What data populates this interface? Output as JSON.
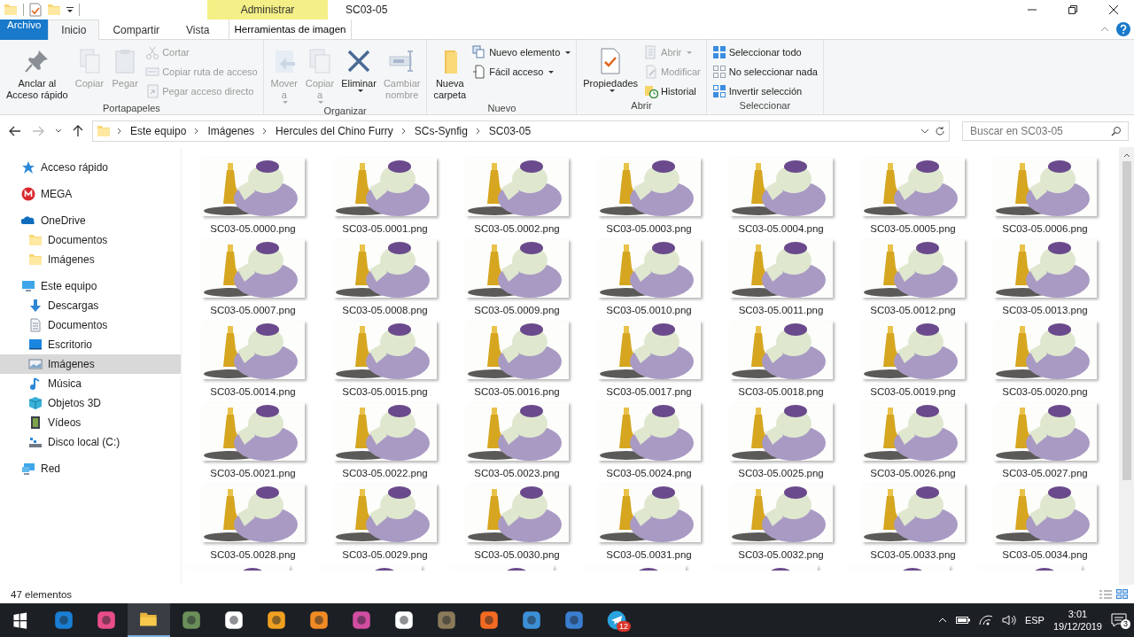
{
  "window": {
    "title": "SC03-05"
  },
  "context_tab": {
    "group": "Administrar",
    "label": "Herramientas de imagen"
  },
  "tabs": [
    {
      "label": "Archivo",
      "kind": "file",
      "selected": false
    },
    {
      "label": "Inicio",
      "kind": "tab",
      "selected": true
    },
    {
      "label": "Compartir",
      "kind": "tab",
      "selected": false
    },
    {
      "label": "Vista",
      "kind": "tab",
      "selected": false
    }
  ],
  "ribbon": [
    {
      "label": "Portapapeles",
      "large": [
        {
          "label": "Anclar al\nAcceso rápido",
          "disabled": false,
          "dropdown": false
        },
        {
          "label": "Copiar",
          "disabled": true,
          "dropdown": false
        },
        {
          "label": "Pegar",
          "disabled": true,
          "dropdown": false
        }
      ],
      "small": [
        {
          "label": "Cortar",
          "disabled": true,
          "dropdown": false
        },
        {
          "label": "Copiar ruta de acceso",
          "disabled": true,
          "dropdown": false
        },
        {
          "label": "Pegar acceso directo",
          "disabled": true,
          "dropdown": false
        }
      ]
    },
    {
      "label": "Organizar",
      "large": [
        {
          "label": "Mover\na",
          "disabled": true,
          "dropdown": true
        },
        {
          "label": "Copiar\na",
          "disabled": true,
          "dropdown": true
        },
        {
          "label": "Eliminar",
          "disabled": false,
          "dropdown": true
        },
        {
          "label": "Cambiar\nnombre",
          "disabled": true,
          "dropdown": false
        }
      ]
    },
    {
      "label": "Nuevo",
      "large": [
        {
          "label": "Nueva\ncarpeta",
          "disabled": false,
          "dropdown": false
        }
      ],
      "small": [
        {
          "label": "Nuevo elemento",
          "disabled": false,
          "dropdown": true
        },
        {
          "label": "Fácil acceso",
          "disabled": false,
          "dropdown": true
        }
      ]
    },
    {
      "label": "Abrir",
      "large": [
        {
          "label": "Propiedades",
          "disabled": false,
          "dropdown": true
        }
      ],
      "small": [
        {
          "label": "Abrir",
          "disabled": true,
          "dropdown": true
        },
        {
          "label": "Modificar",
          "disabled": true,
          "dropdown": false
        },
        {
          "label": "Historial",
          "disabled": false,
          "dropdown": false
        }
      ]
    },
    {
      "label": "Seleccionar",
      "small": [
        {
          "label": "Seleccionar todo",
          "disabled": false,
          "dropdown": false
        },
        {
          "label": "No seleccionar nada",
          "disabled": false,
          "dropdown": false
        },
        {
          "label": "Invertir selección",
          "disabled": false,
          "dropdown": false
        }
      ]
    }
  ],
  "address": {
    "crumbs": [
      "Este equipo",
      "Imágenes",
      "Hercules del Chino Furry",
      "SCs-Synfig",
      "SC03-05"
    ]
  },
  "search": {
    "placeholder": "Buscar en SC03-05"
  },
  "sidebar": {
    "items": [
      {
        "label": "Acceso rápido",
        "selected": false
      },
      {
        "label": "MEGA",
        "selected": false
      },
      {
        "label": "OneDrive",
        "selected": false,
        "children": [
          {
            "label": "Documentos",
            "selected": false
          },
          {
            "label": "Imágenes",
            "selected": false
          }
        ]
      },
      {
        "label": "Este equipo",
        "selected": false,
        "children": [
          {
            "label": "Descargas",
            "selected": false
          },
          {
            "label": "Documentos",
            "selected": false
          },
          {
            "label": "Escritorio",
            "selected": false
          },
          {
            "label": "Imágenes",
            "selected": true
          },
          {
            "label": "Música",
            "selected": false
          },
          {
            "label": "Objetos 3D",
            "selected": false
          },
          {
            "label": "Vídeos",
            "selected": false
          },
          {
            "label": "Disco local (C:)",
            "selected": false
          }
        ]
      },
      {
        "label": "Red",
        "selected": false
      }
    ]
  },
  "files": [
    "SC03-05.0000.png",
    "SC03-05.0001.png",
    "SC03-05.0002.png",
    "SC03-05.0003.png",
    "SC03-05.0004.png",
    "SC03-05.0005.png",
    "SC03-05.0006.png",
    "SC03-05.0007.png",
    "SC03-05.0008.png",
    "SC03-05.0009.png",
    "SC03-05.0010.png",
    "SC03-05.0011.png",
    "SC03-05.0012.png",
    "SC03-05.0013.png",
    "SC03-05.0014.png",
    "SC03-05.0015.png",
    "SC03-05.0016.png",
    "SC03-05.0017.png",
    "SC03-05.0018.png",
    "SC03-05.0019.png",
    "SC03-05.0020.png",
    "SC03-05.0021.png",
    "SC03-05.0022.png",
    "SC03-05.0023.png",
    "SC03-05.0024.png",
    "SC03-05.0025.png",
    "SC03-05.0026.png",
    "SC03-05.0027.png",
    "SC03-05.0028.png",
    "SC03-05.0029.png",
    "SC03-05.0030.png",
    "SC03-05.0031.png",
    "SC03-05.0032.png",
    "SC03-05.0033.png",
    "SC03-05.0034.png"
  ],
  "status_bar": {
    "count": "47 elementos"
  },
  "taskbar": {
    "apps": [
      {
        "selected": false
      },
      {
        "selected": false
      },
      {
        "selected": true
      },
      {
        "selected": false
      },
      {
        "selected": false
      },
      {
        "selected": false
      },
      {
        "selected": false
      },
      {
        "selected": false
      },
      {
        "selected": false
      },
      {
        "selected": false
      },
      {
        "selected": false
      },
      {
        "selected": false
      },
      {
        "selected": false
      },
      {
        "selected": false,
        "badge": "12"
      }
    ],
    "language": "ESP",
    "time": "3:01",
    "date": "19/12/2019",
    "notifications": "3"
  }
}
